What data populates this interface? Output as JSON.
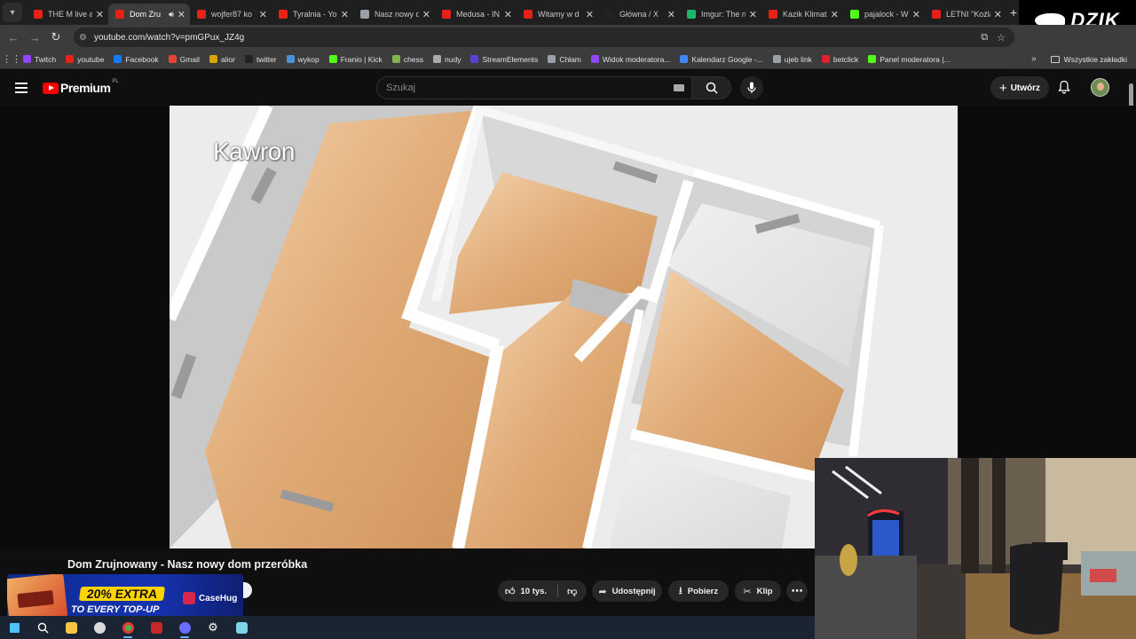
{
  "browser": {
    "tabs": [
      {
        "title": "THE M live a",
        "color": "#e62117",
        "active": false
      },
      {
        "title": "Dom Zru",
        "color": "#e62117",
        "active": true,
        "audio": true
      },
      {
        "title": "wojfer87 ko",
        "color": "#e62117",
        "active": false
      },
      {
        "title": "Tyralnia - Yo",
        "color": "#e62117",
        "active": false
      },
      {
        "title": "Nasz nowy d",
        "color": "#9aa0a6",
        "active": false
      },
      {
        "title": "Medusa - IN",
        "color": "#e62117",
        "active": false
      },
      {
        "title": "Witamy w d",
        "color": "#e62117",
        "active": false
      },
      {
        "title": "Główna / X",
        "color": "#222222",
        "active": false
      },
      {
        "title": "Imgur: The n",
        "color": "#1bb76e",
        "active": false
      },
      {
        "title": "Kazik Klimat",
        "color": "#e62117",
        "active": false
      },
      {
        "title": "pajalock - W",
        "color": "#53fc18",
        "active": false
      },
      {
        "title": "LETNI \"Koźla",
        "color": "#e62117",
        "active": false
      }
    ],
    "url": "youtube.com/watch?v=pmGPux_JZ4g",
    "bookmarks": [
      {
        "label": "Twitch",
        "color": "#9146ff"
      },
      {
        "label": "youtube",
        "color": "#e62117"
      },
      {
        "label": "Facebook",
        "color": "#1877f2"
      },
      {
        "label": "Gmail",
        "color": "#ea4335"
      },
      {
        "label": "alior",
        "color": "#d9a400"
      },
      {
        "label": "twitter",
        "color": "#222222"
      },
      {
        "label": "wykop",
        "color": "#4a90d9"
      },
      {
        "label": "Franio | Kick",
        "color": "#53fc18"
      },
      {
        "label": "chess",
        "color": "#81b64c"
      },
      {
        "label": "nudy",
        "color": "#aaaaaa"
      },
      {
        "label": "StreamElements",
        "color": "#5a3fd6"
      },
      {
        "label": "Chłam",
        "color": "#9aa0a6"
      },
      {
        "label": "Widok moderatora...",
        "color": "#9146ff"
      },
      {
        "label": "Kalendarz Google -...",
        "color": "#4285f4"
      },
      {
        "label": "ujeb link",
        "color": "#9aa0a6"
      },
      {
        "label": "betclick",
        "color": "#e21e2f"
      },
      {
        "label": "Panel moderatora |...",
        "color": "#53fc18"
      }
    ],
    "all_bookmarks_label": "Wszystkie zakładki",
    "dzik_label": "DZIK"
  },
  "youtube": {
    "logo_text": "Premium",
    "logo_region": "PL",
    "search_placeholder": "Szukaj",
    "create_label": "Utwórz",
    "video_overlay_text": "Kawron",
    "video_title": "Dom Zrujnowany - Nasz nowy dom przeróbka",
    "likes": "10 tys.",
    "share_label": "Udostępnij",
    "download_label": "Pobierz",
    "clip_label": "Klip"
  },
  "ad": {
    "line1": "20% EXTRA",
    "line2": "TO EVERY TOP-UP",
    "brand": "CaseHug"
  }
}
